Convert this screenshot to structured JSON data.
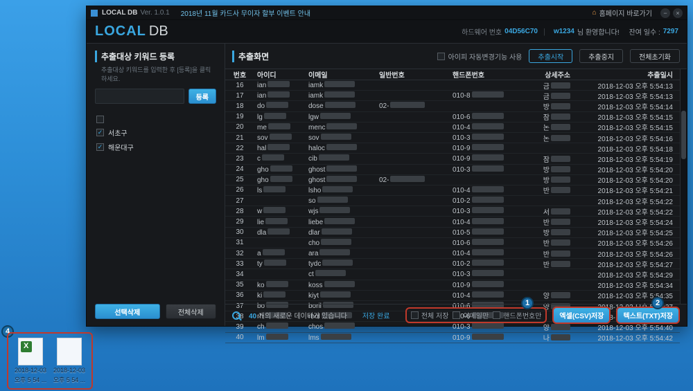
{
  "titlebar": {
    "title": "LOCAL DB",
    "version": "Ver. 1.0.1",
    "announce": "2018년 11월 카드사 무이자 할부 이벤트 안내",
    "home": "홈페이지 바로가기"
  },
  "header": {
    "logo_local": "LOCAL",
    "logo_db": "DB",
    "hw_label": "하드웨어 번호",
    "hw_value": "04D56C70",
    "user_acc": "w1234",
    "greet": "님 환영합니다!",
    "remain_label": "잔여 일수 :",
    "remain_value": "7297"
  },
  "sidebar": {
    "title": "추출대상 키워드 등록",
    "subtitle": "추출대상 키워드를 입력한 후 [등록]을 클릭하세요.",
    "btn_register": "등록",
    "keywords": [
      {
        "checked": true,
        "label": "서초구"
      },
      {
        "checked": true,
        "label": "해운대구"
      }
    ],
    "header_empty": {
      "checked": false,
      "label": ""
    },
    "btn_sel_del": "선택삭제",
    "btn_all_del": "전체삭제"
  },
  "main": {
    "title": "추출화면",
    "ip_auto": "아이피 자동변경기능 사용",
    "btn_start": "추출시작",
    "btn_stop": "추출중지",
    "btn_reset": "전체초기화",
    "columns": {
      "no": "번호",
      "id": "아이디",
      "em": "이메일",
      "gn": "일반번호",
      "ph": "핸드폰번호",
      "ad": "상세주소",
      "dt": "추출일시"
    },
    "rows": [
      {
        "no": "16",
        "id": "ian",
        "em": "iamk",
        "gn": "",
        "ph": "",
        "ad": "금",
        "dt": "2018-12-03 오후 5:54:13"
      },
      {
        "no": "17",
        "id": "ian",
        "em": "iamk",
        "gn": "",
        "ph": "010-8",
        "ad": "금",
        "dt": "2018-12-03 오후 5:54:13"
      },
      {
        "no": "18",
        "id": "do",
        "em": "dose",
        "gn": "02-",
        "ph": "",
        "ad": "방",
        "dt": "2018-12-03 오후 5:54:14"
      },
      {
        "no": "19",
        "id": "lg",
        "em": "lgw",
        "gn": "",
        "ph": "010-6",
        "ad": "잠",
        "dt": "2018-12-03 오후 5:54:15"
      },
      {
        "no": "20",
        "id": "me",
        "em": "menc",
        "gn": "",
        "ph": "010-4",
        "ad": "논",
        "dt": "2018-12-03 오후 5:54:15"
      },
      {
        "no": "21",
        "id": "sov",
        "em": "sov",
        "gn": "",
        "ph": "010-3",
        "ad": "논",
        "dt": "2018-12-03 오후 5:54:16"
      },
      {
        "no": "22",
        "id": "hal",
        "em": "haloc",
        "gn": "",
        "ph": "010-9",
        "ad": "",
        "dt": "2018-12-03 오후 5:54:18"
      },
      {
        "no": "23",
        "id": "c",
        "em": "cib",
        "gn": "",
        "ph": "010-9",
        "ad": "잠",
        "dt": "2018-12-03 오후 5:54:19"
      },
      {
        "no": "24",
        "id": "gho",
        "em": "ghost",
        "gn": "",
        "ph": "010-3",
        "ad": "방",
        "dt": "2018-12-03 오후 5:54:20"
      },
      {
        "no": "25",
        "id": "gho",
        "em": "ghost",
        "gn": "02-",
        "ph": "",
        "ad": "방",
        "dt": "2018-12-03 오후 5:54:20"
      },
      {
        "no": "26",
        "id": "ls",
        "em": "lsho",
        "gn": "",
        "ph": "010-4",
        "ad": "반",
        "dt": "2018-12-03 오후 5:54:21"
      },
      {
        "no": "27",
        "id": "",
        "em": "so",
        "gn": "",
        "ph": "010-2",
        "ad": "",
        "dt": "2018-12-03 오후 5:54:22"
      },
      {
        "no": "28",
        "id": "w",
        "em": "wjs",
        "gn": "",
        "ph": "010-3",
        "ad": "서",
        "dt": "2018-12-03 오후 5:54:22"
      },
      {
        "no": "29",
        "id": "lie",
        "em": "liebe",
        "gn": "",
        "ph": "010-4",
        "ad": "반",
        "dt": "2018-12-03 오후 5:54:24"
      },
      {
        "no": "30",
        "id": "dla",
        "em": "dlar",
        "gn": "",
        "ph": "010-5",
        "ad": "방",
        "dt": "2018-12-03 오후 5:54:25"
      },
      {
        "no": "31",
        "id": "",
        "em": "cho",
        "gn": "",
        "ph": "010-6",
        "ad": "반",
        "dt": "2018-12-03 오후 5:54:26"
      },
      {
        "no": "32",
        "id": "a",
        "em": "ara",
        "gn": "",
        "ph": "010-4",
        "ad": "반",
        "dt": "2018-12-03 오후 5:54:26"
      },
      {
        "no": "33",
        "id": "ty",
        "em": "tydc",
        "gn": "",
        "ph": "010-2",
        "ad": "반",
        "dt": "2018-12-03 오후 5:54:27"
      },
      {
        "no": "34",
        "id": "",
        "em": "ct",
        "gn": "",
        "ph": "010-3",
        "ad": "",
        "dt": "2018-12-03 오후 5:54:29"
      },
      {
        "no": "35",
        "id": "ko",
        "em": "koss",
        "gn": "",
        "ph": "010-9",
        "ad": "",
        "dt": "2018-12-03 오후 5:54:34"
      },
      {
        "no": "36",
        "id": "ki",
        "em": "kiyt",
        "gn": "",
        "ph": "010-4",
        "ad": "양",
        "dt": "2018-12-03 오후 5:54:35"
      },
      {
        "no": "37",
        "id": "bo",
        "em": "boril",
        "gn": "",
        "ph": "010-6",
        "ad": "양",
        "dt": "2018-12-03 오후 5:54:37"
      },
      {
        "no": "38",
        "id": "rh",
        "em": "rhol",
        "gn": "",
        "ph": "010-6",
        "ad": "",
        "dt": "2018-12-03 오후 5:54:37"
      },
      {
        "no": "39",
        "id": "ch",
        "em": "chos",
        "gn": "",
        "ph": "010-3",
        "ad": "양",
        "dt": "2018-12-03 오후 5:54:40"
      },
      {
        "no": "40",
        "id": "lm",
        "em": "lms",
        "gn": "",
        "ph": "010-9",
        "ad": "나",
        "dt": "2018-12-03 오후 5:54:42"
      }
    ],
    "footer": {
      "count_prefix": "40",
      "count_text": "개의 새로운 데이터가 있습니다",
      "done": "저장 완료",
      "so_full": "전체 저장",
      "so_email": "이메일만",
      "so_phone": "핸드폰번호만",
      "btn_csv": "엑셀(CSV)저장",
      "btn_txt": "텍스트(TXT)저장"
    }
  },
  "desktop": {
    "file1": {
      "name": "2018-12-03",
      "sub": "오후 5 54 ..."
    },
    "file2": {
      "name": "2018-12-03",
      "sub": "오후 5 54 ..."
    }
  },
  "badges": {
    "b1": "1",
    "b2": "2",
    "b3": "3",
    "b4": "4"
  }
}
